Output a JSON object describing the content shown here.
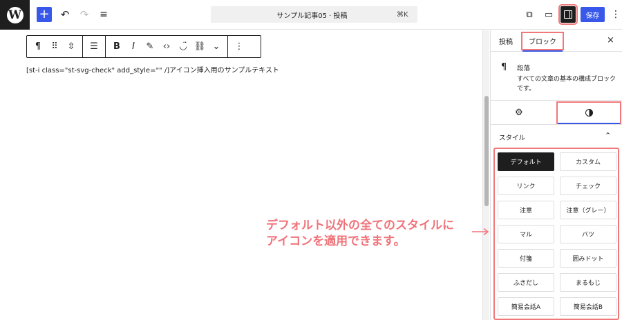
{
  "topbar": {
    "wp_logo": "W",
    "add_icon": "+",
    "undo_icon": "↶",
    "redo_icon": "↷",
    "listview_icon": "≡",
    "command_bar_title": "サンプル記事05 · 投稿",
    "command_shortcut": "⌘K",
    "view_icon": "⧉",
    "preview_icon": "▭",
    "save_label": "保存",
    "more_icon": "⋮"
  },
  "block_toolbar": {
    "paragraph_icon": "¶",
    "drag_icon": "⠿",
    "move_icon": "⇳",
    "align_icon": "☰",
    "bold": "B",
    "italic": "I",
    "highlight_icon": "✎",
    "code_icon": "‹›",
    "emoji_icon": "◡̈",
    "link_icon": "⛓",
    "chevron_icon": "⌄",
    "options_icon": "⋮"
  },
  "editor": {
    "paragraph_text": "[st-i class=\"st-svg-check\" add_style=\"\" /]アイコン挿入用のサンプルテキスト"
  },
  "sidebar": {
    "tab_post": "投稿",
    "tab_block": "ブロック",
    "close_icon": "×",
    "block_icon": "¶",
    "block_title": "段落",
    "block_description": "すべての文章の基本の構成ブロックです。",
    "settings_icon": "⚙",
    "styles_heading": "スタイル",
    "collapse_icon": "⌃",
    "styles": [
      "デフォルト",
      "カスタム",
      "リンク",
      "チェック",
      "注意",
      "注意（グレー）",
      "マル",
      "バツ",
      "付箋",
      "囲みドット",
      "ふきだし",
      "まるもじ",
      "簡易会話A",
      "簡易会話B"
    ]
  },
  "annotation": {
    "line1": "デフォルト以外の全てのスタイルに",
    "line2": "アイコンを適用できます。",
    "color": "#f0737a"
  },
  "colors": {
    "accent": "#3858e9",
    "highlight_border": "#f0787a",
    "dark": "#1e1e1e"
  }
}
